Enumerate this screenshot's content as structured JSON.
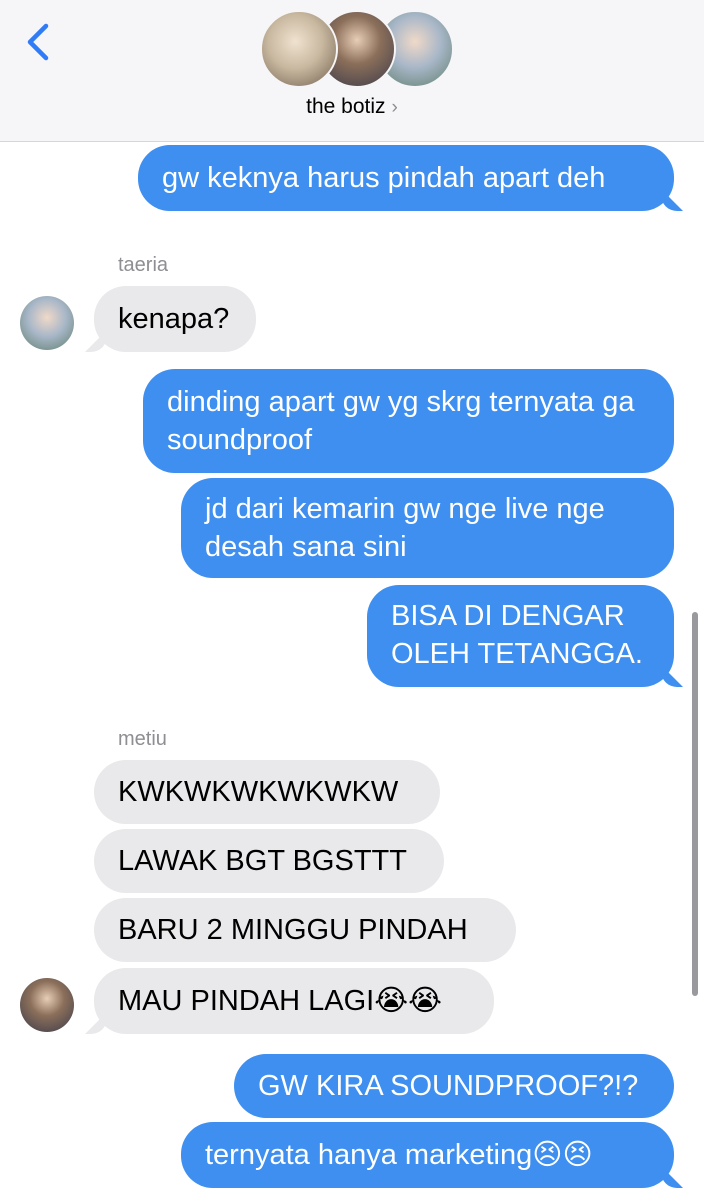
{
  "header": {
    "title": "the botiz",
    "back_icon": "chevron-left-icon",
    "disclosure": "›",
    "accent": "#2f7cf6"
  },
  "messages": [
    {
      "side": "out",
      "text": "gw keknya harus pindah apart deh"
    },
    {
      "side": "in",
      "sender": "taeria",
      "text": "kenapa?"
    },
    {
      "side": "out",
      "text": "dinding apart gw yg skrg ternyata ga soundproof"
    },
    {
      "side": "out",
      "text": "jd dari kemarin gw nge live nge desah sana sini"
    },
    {
      "side": "out",
      "text": "BISA DI DENGAR OLEH TETANGGA."
    },
    {
      "side": "in",
      "sender": "metiu",
      "text": "KWKWKWKWKWKW"
    },
    {
      "side": "in",
      "text": "LAWAK BGT BGSTTT"
    },
    {
      "side": "in",
      "text": "BARU 2 MINGGU PINDAH"
    },
    {
      "side": "in",
      "text": "MAU PINDAH LAGI😭😭"
    },
    {
      "side": "out",
      "text": "GW KIRA SOUNDPROOF?!?"
    },
    {
      "side": "out",
      "text": "ternyata hanya marketing😣😣"
    }
  ],
  "colors": {
    "outgoing": "#3e8ff0",
    "incoming": "#e9e9eb",
    "sender_name": "#8e8e93"
  }
}
